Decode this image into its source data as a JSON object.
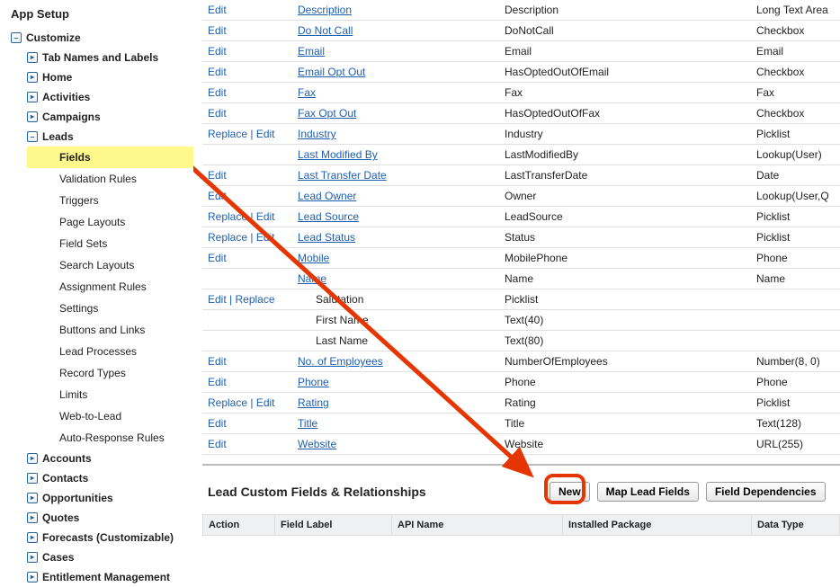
{
  "sidebar": {
    "title": "App Setup",
    "customize": {
      "label": "Customize",
      "items": [
        {
          "label": "Tab Names and Labels"
        },
        {
          "label": "Home"
        },
        {
          "label": "Activities"
        },
        {
          "label": "Campaigns"
        }
      ],
      "leads": {
        "label": "Leads",
        "children": [
          {
            "label": "Fields",
            "highlight": true
          },
          {
            "label": "Validation Rules"
          },
          {
            "label": "Triggers"
          },
          {
            "label": "Page Layouts"
          },
          {
            "label": "Field Sets"
          },
          {
            "label": "Search Layouts"
          },
          {
            "label": "Assignment Rules"
          },
          {
            "label": "Settings"
          },
          {
            "label": "Buttons and Links"
          },
          {
            "label": "Lead Processes"
          },
          {
            "label": "Record Types"
          },
          {
            "label": "Limits"
          },
          {
            "label": "Web-to-Lead"
          },
          {
            "label": "Auto-Response Rules"
          }
        ]
      },
      "after": [
        {
          "label": "Accounts"
        },
        {
          "label": "Contacts"
        },
        {
          "label": "Opportunities"
        },
        {
          "label": "Quotes"
        },
        {
          "label": "Forecasts (Customizable)"
        },
        {
          "label": "Cases"
        },
        {
          "label": "Entitlement Management"
        }
      ]
    }
  },
  "actions": {
    "edit": "Edit",
    "replace": "Replace",
    "sep": " | "
  },
  "fields": [
    {
      "action": "edit",
      "label": "Description",
      "api": "Description",
      "type": "Long Text Area"
    },
    {
      "action": "edit",
      "label": "Do Not Call",
      "api": "DoNotCall",
      "type": "Checkbox"
    },
    {
      "action": "edit",
      "label": "Email",
      "api": "Email",
      "type": "Email"
    },
    {
      "action": "edit",
      "label": "Email Opt Out",
      "api": "HasOptedOutOfEmail",
      "type": "Checkbox"
    },
    {
      "action": "edit",
      "label": "Fax",
      "api": "Fax",
      "type": "Fax"
    },
    {
      "action": "edit",
      "label": "Fax Opt Out",
      "api": "HasOptedOutOfFax",
      "type": "Checkbox"
    },
    {
      "action": "replace_edit",
      "label": "Industry",
      "api": "Industry",
      "type": "Picklist"
    },
    {
      "action": "",
      "label": "Last Modified By",
      "api": "LastModifiedBy",
      "type": "Lookup(User)"
    },
    {
      "action": "edit",
      "label": "Last Transfer Date",
      "api": "LastTransferDate",
      "type": "Date"
    },
    {
      "action": "edit",
      "label": "Lead Owner",
      "api": "Owner",
      "type": "Lookup(User,Q"
    },
    {
      "action": "replace_edit",
      "label": "Lead Source",
      "api": "LeadSource",
      "type": "Picklist"
    },
    {
      "action": "replace_edit",
      "label": "Lead Status",
      "api": "Status",
      "type": "Picklist"
    },
    {
      "action": "edit",
      "label": "Mobile",
      "api": "MobilePhone",
      "type": "Phone"
    },
    {
      "action": "",
      "label": "Name",
      "api": "Name",
      "type": "Name"
    },
    {
      "action": "edit_replace",
      "label": "Salutation",
      "indent": true,
      "api": "Picklist",
      "type": ""
    },
    {
      "action": "",
      "label": "First Name",
      "indent": true,
      "api": "Text(40)",
      "type": ""
    },
    {
      "action": "",
      "label": "Last Name",
      "indent": true,
      "api": "Text(80)",
      "type": ""
    },
    {
      "action": "edit",
      "label": "No. of Employees",
      "api": "NumberOfEmployees",
      "type": "Number(8, 0)"
    },
    {
      "action": "edit",
      "label": "Phone",
      "api": "Phone",
      "type": "Phone"
    },
    {
      "action": "replace_edit",
      "label": "Rating",
      "api": "Rating",
      "type": "Picklist"
    },
    {
      "action": "edit",
      "label": "Title",
      "api": "Title",
      "type": "Text(128)"
    },
    {
      "action": "edit",
      "label": "Website",
      "api": "Website",
      "type": "URL(255)"
    }
  ],
  "customSection": {
    "title": "Lead Custom Fields & Relationships",
    "buttons": {
      "new": "New",
      "map": "Map Lead Fields",
      "deps": "Field Dependencies"
    },
    "columns": {
      "action": "Action",
      "label": "Field Label",
      "api": "API Name",
      "pkg": "Installed Package",
      "type": "Data Type"
    }
  }
}
